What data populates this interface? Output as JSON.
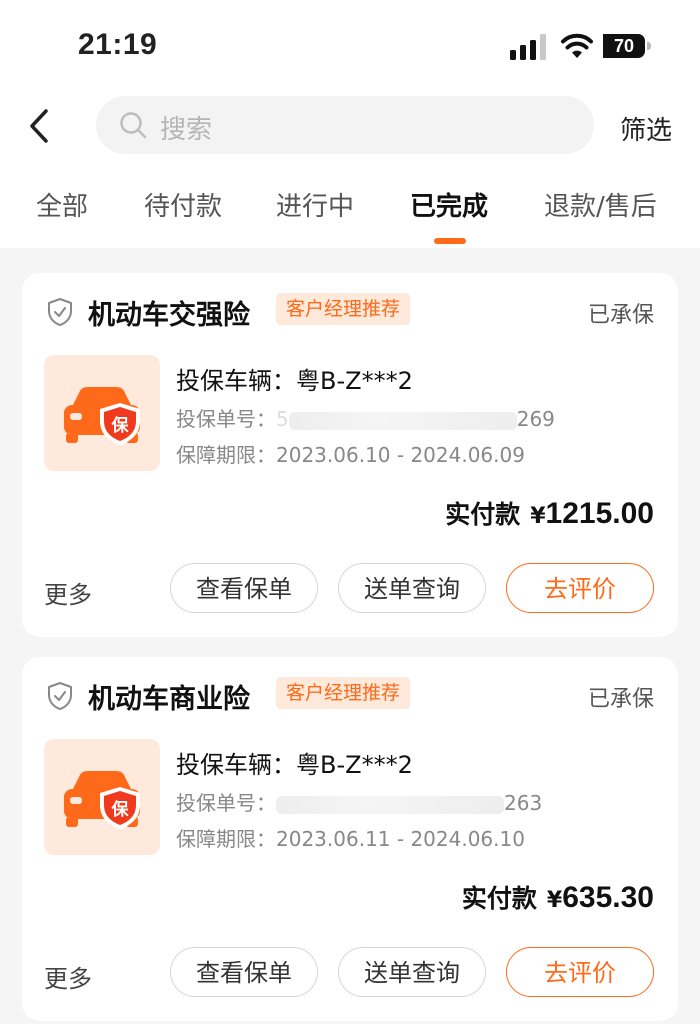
{
  "status_bar": {
    "time": "21:19",
    "battery": "70",
    "battery_level": 0.7
  },
  "header": {
    "search_placeholder": "搜索",
    "filter_label": "筛选"
  },
  "tabs": [
    {
      "label": "全部",
      "active": false
    },
    {
      "label": "待付款",
      "active": false
    },
    {
      "label": "进行中",
      "active": false
    },
    {
      "label": "已完成",
      "active": true
    },
    {
      "label": "退款/售后",
      "active": false
    }
  ],
  "colors": {
    "accent": "#ff6a1a",
    "tag_bg": "#ffe9da",
    "background": "#f5f5f5"
  },
  "orders": [
    {
      "title": "机动车交强险",
      "tag": "客户经理推荐",
      "status": "已承保",
      "vehicle_label": "投保车辆：",
      "vehicle": "粤B-Z***2",
      "policy_label": "投保单号：",
      "policy_prefix": "5",
      "policy_suffix": "269",
      "period_label": "保障期限：",
      "period": "2023.06.10 - 2024.06.09",
      "pay_label": "实付款",
      "currency": "¥",
      "amount": "1215.00",
      "more": "更多",
      "btn_view": "查看保单",
      "btn_delivery": "送单查询",
      "btn_review": "去评价",
      "icon_text": "保"
    },
    {
      "title": "机动车商业险",
      "tag": "客户经理推荐",
      "status": "已承保",
      "vehicle_label": "投保车辆：",
      "vehicle": "粤B-Z***2",
      "policy_label": "投保单号：",
      "policy_prefix": "",
      "policy_suffix": "263",
      "period_label": "保障期限：",
      "period": "2023.06.11 - 2024.06.10",
      "pay_label": "实付款",
      "currency": "¥",
      "amount": "635.30",
      "more": "更多",
      "btn_view": "查看保单",
      "btn_delivery": "送单查询",
      "btn_review": "去评价",
      "icon_text": "保"
    }
  ]
}
